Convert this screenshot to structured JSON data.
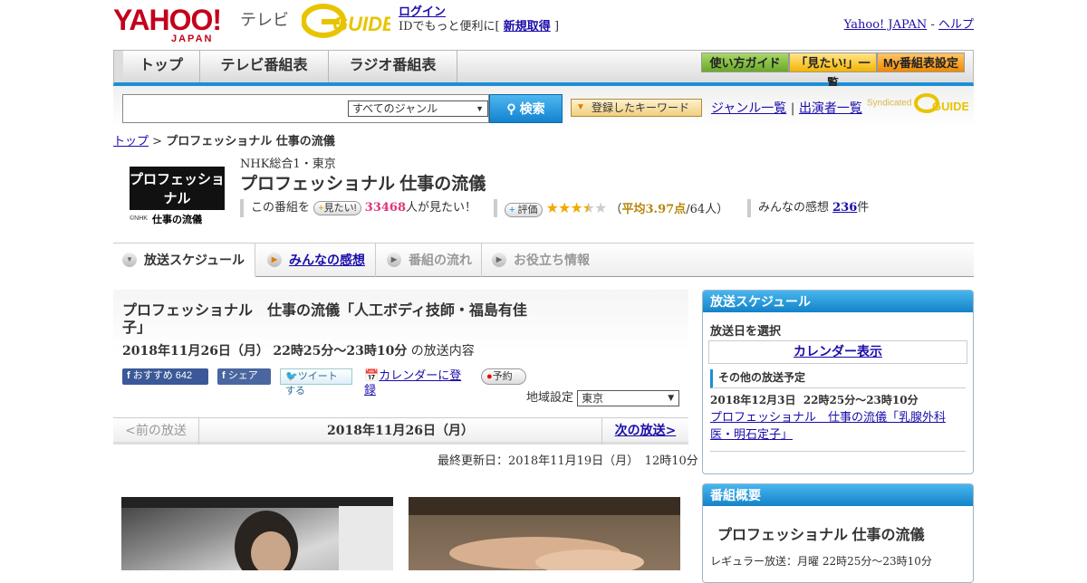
{
  "header": {
    "logo": "YAHOO!",
    "logo_sub": "JAPAN",
    "tv_label": "テレビ",
    "gguide": "G-GUIDE",
    "login": "ログイン",
    "login_desc": "IDでもっと便利に[",
    "signup": "新規取得",
    "signup_after": "]",
    "yahoo_japan": "Yahoo! JAPAN",
    "separator": "-",
    "help": "ヘルプ"
  },
  "nav": {
    "tabs": [
      "トップ",
      "テレビ番組表",
      "ラジオ番組表"
    ],
    "buttons": [
      "使い方ガイド",
      "「見たい!」一覧",
      "My番組表設定"
    ]
  },
  "search": {
    "genre": "すべてのジャンル",
    "search_btn": "検索",
    "keyword_btn": "登録したキーワード",
    "genre_list": "ジャンル一覧",
    "divider": "|",
    "performer_list": "出演者一覧",
    "syndicated": "Syndicated"
  },
  "breadcrumb": {
    "top": "トップ",
    "sep": ">",
    "current": "プロフェッショナル 仕事の流儀"
  },
  "program": {
    "thumb_main": "プロフェッショナル",
    "thumb_sub": "仕事の流儀",
    "thumb_credit": "©NHK",
    "channel": "NHK総合1・東京",
    "title": "プロフェッショナル 仕事の流儀",
    "want_prefix": "この番組を",
    "want_button": "見たい!",
    "want_count": "33468",
    "want_suffix": "人が見たい！",
    "rating_button": "評価",
    "rating_value": 3.97,
    "rating_text_open": "（",
    "rating_avg": "平均3.97点",
    "rating_votes": "/64人）",
    "review_prefix": "みんなの感想",
    "review_count": "236",
    "review_suffix": "件"
  },
  "tabs": [
    {
      "label": "放送スケジュール",
      "active": true
    },
    {
      "label": "みんなの感想",
      "link": true
    },
    {
      "label": "番組の流れ"
    },
    {
      "label": "お役立ち情報"
    }
  ],
  "episode": {
    "title": "プロフェッショナル　仕事の流儀「人工ボディ技師・福島有佳子」",
    "date": "2018年11月26日（月）",
    "time": "22時25分～23時10分",
    "suffix": "の放送内容",
    "social": {
      "fb_recommend": "おすすめ",
      "fb_count": "642",
      "fb_share": "シェア",
      "tweet": "ツイートする",
      "calendar": "カレンダーに登録",
      "reserve": "予約"
    },
    "region_label": "地域設定",
    "region_value": "東京"
  },
  "pager": {
    "prev": "<前の放送",
    "current": "2018年11月26日（月）",
    "next": "次の放送>"
  },
  "updated": "最終更新日：2018年11月19日（月）　12時10分",
  "sidebar": {
    "schedule": {
      "header": "放送スケジュール",
      "select_date": "放送日を選択",
      "calendar": "カレンダー表示",
      "other_header": "その他の放送予定",
      "other_date": "2018年12月3日",
      "other_time": "22時25分～23時10分",
      "other_title": "プロフェッショナル　仕事の流儀「乳腺外科医・明石定子」"
    },
    "overview": {
      "header": "番組概要",
      "title": "プロフェッショナル 仕事の流儀",
      "regular": "レギュラー放送：月曜 22時25分～23時10分"
    }
  },
  "colors": {
    "accent_blue": "#1b8fd6",
    "pink": "#e0337a",
    "star": "#f2a800",
    "rating_gold": "#b8860b"
  }
}
